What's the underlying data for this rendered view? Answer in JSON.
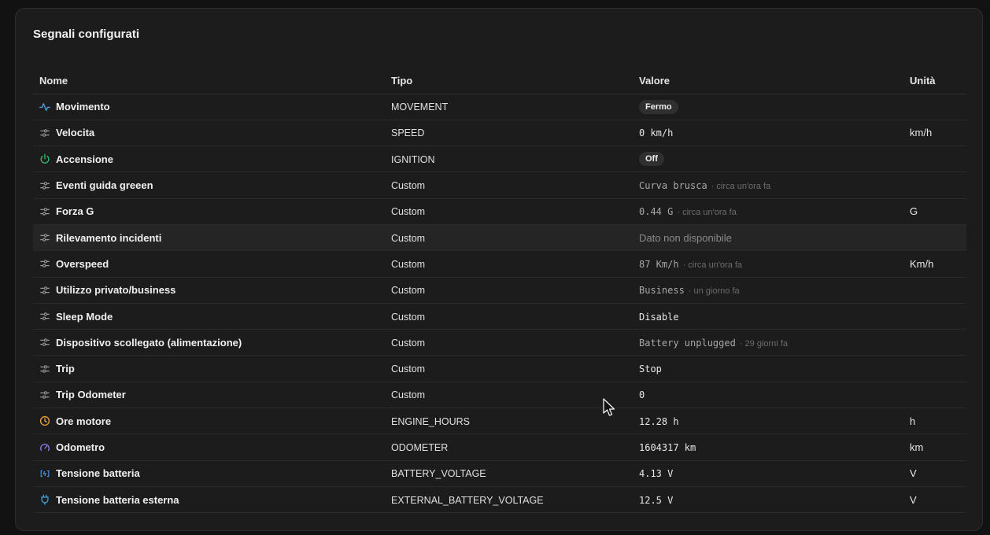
{
  "card": {
    "title": "Segnali configurati"
  },
  "headers": {
    "name": "Nome",
    "type": "Tipo",
    "value": "Valore",
    "unit": "Unità"
  },
  "rows": [
    {
      "icon": "activity-icon",
      "name": "Movimento",
      "type": "MOVEMENT",
      "value_kind": "badge",
      "value": "Fermo",
      "ago": "",
      "unit": ""
    },
    {
      "icon": "sliders-icon",
      "name": "Velocita",
      "type": "SPEED",
      "value_kind": "mono",
      "value": "0 km/h",
      "ago": "",
      "unit": "km/h"
    },
    {
      "icon": "power-icon",
      "name": "Accensione",
      "type": "IGNITION",
      "value_kind": "badge",
      "value": "Off",
      "ago": "",
      "unit": ""
    },
    {
      "icon": "sliders-icon",
      "name": "Eventi guida greeen",
      "type": "Custom",
      "value_kind": "mono-dim",
      "value": "Curva brusca",
      "ago": "· circa un'ora fa",
      "unit": ""
    },
    {
      "icon": "sliders-icon",
      "name": "Forza G",
      "type": "Custom",
      "value_kind": "mono-dim",
      "value": "0.44 G",
      "ago": "· circa un'ora fa",
      "unit": "G"
    },
    {
      "icon": "sliders-icon",
      "name": "Rilevamento incidenti",
      "type": "Custom",
      "value_kind": "unavailable",
      "value": "Dato non disponibile",
      "ago": "",
      "unit": ""
    },
    {
      "icon": "sliders-icon",
      "name": "Overspeed",
      "type": "Custom",
      "value_kind": "mono-dim",
      "value": "87 Km/h",
      "ago": "· circa un'ora fa",
      "unit": "Km/h"
    },
    {
      "icon": "sliders-icon",
      "name": "Utilizzo privato/business",
      "type": "Custom",
      "value_kind": "mono-dim",
      "value": "Business",
      "ago": "· un giorno fa",
      "unit": ""
    },
    {
      "icon": "sliders-icon",
      "name": "Sleep Mode",
      "type": "Custom",
      "value_kind": "mono",
      "value": "Disable",
      "ago": "",
      "unit": ""
    },
    {
      "icon": "sliders-icon",
      "name": "Dispositivo scollegato (alimentazione)",
      "type": "Custom",
      "value_kind": "mono-dim",
      "value": "Battery unplugged",
      "ago": "· 29 giorni fa",
      "unit": ""
    },
    {
      "icon": "sliders-icon",
      "name": "Trip",
      "type": "Custom",
      "value_kind": "mono",
      "value": "Stop",
      "ago": "",
      "unit": ""
    },
    {
      "icon": "sliders-icon",
      "name": "Trip Odometer",
      "type": "Custom",
      "value_kind": "mono",
      "value": "0",
      "ago": "",
      "unit": ""
    },
    {
      "icon": "clock-icon",
      "name": "Ore motore",
      "type": "ENGINE_HOURS",
      "value_kind": "mono",
      "value": "12.28 h",
      "ago": "",
      "unit": "h"
    },
    {
      "icon": "gauge-icon",
      "name": "Odometro",
      "type": "ODOMETER",
      "value_kind": "mono",
      "value": "1604317 km",
      "ago": "",
      "unit": "km"
    },
    {
      "icon": "battery-icon",
      "name": "Tensione batteria",
      "type": "BATTERY_VOLTAGE",
      "value_kind": "mono",
      "value": "4.13 V",
      "ago": "",
      "unit": "V"
    },
    {
      "icon": "plug-icon",
      "name": "Tensione batteria esterna",
      "type": "EXTERNAL_BATTERY_VOLTAGE",
      "value_kind": "mono",
      "value": "12.5 V",
      "ago": "",
      "unit": "V"
    }
  ],
  "highlight_row": 5,
  "colors": {
    "activity": "#4aa3df",
    "sliders": "#9a9a9a",
    "power": "#2fbf71",
    "clock": "#e8a33a",
    "gauge": "#8b7cf0",
    "battery": "#4a8fe8",
    "plug": "#3aa0d8"
  }
}
